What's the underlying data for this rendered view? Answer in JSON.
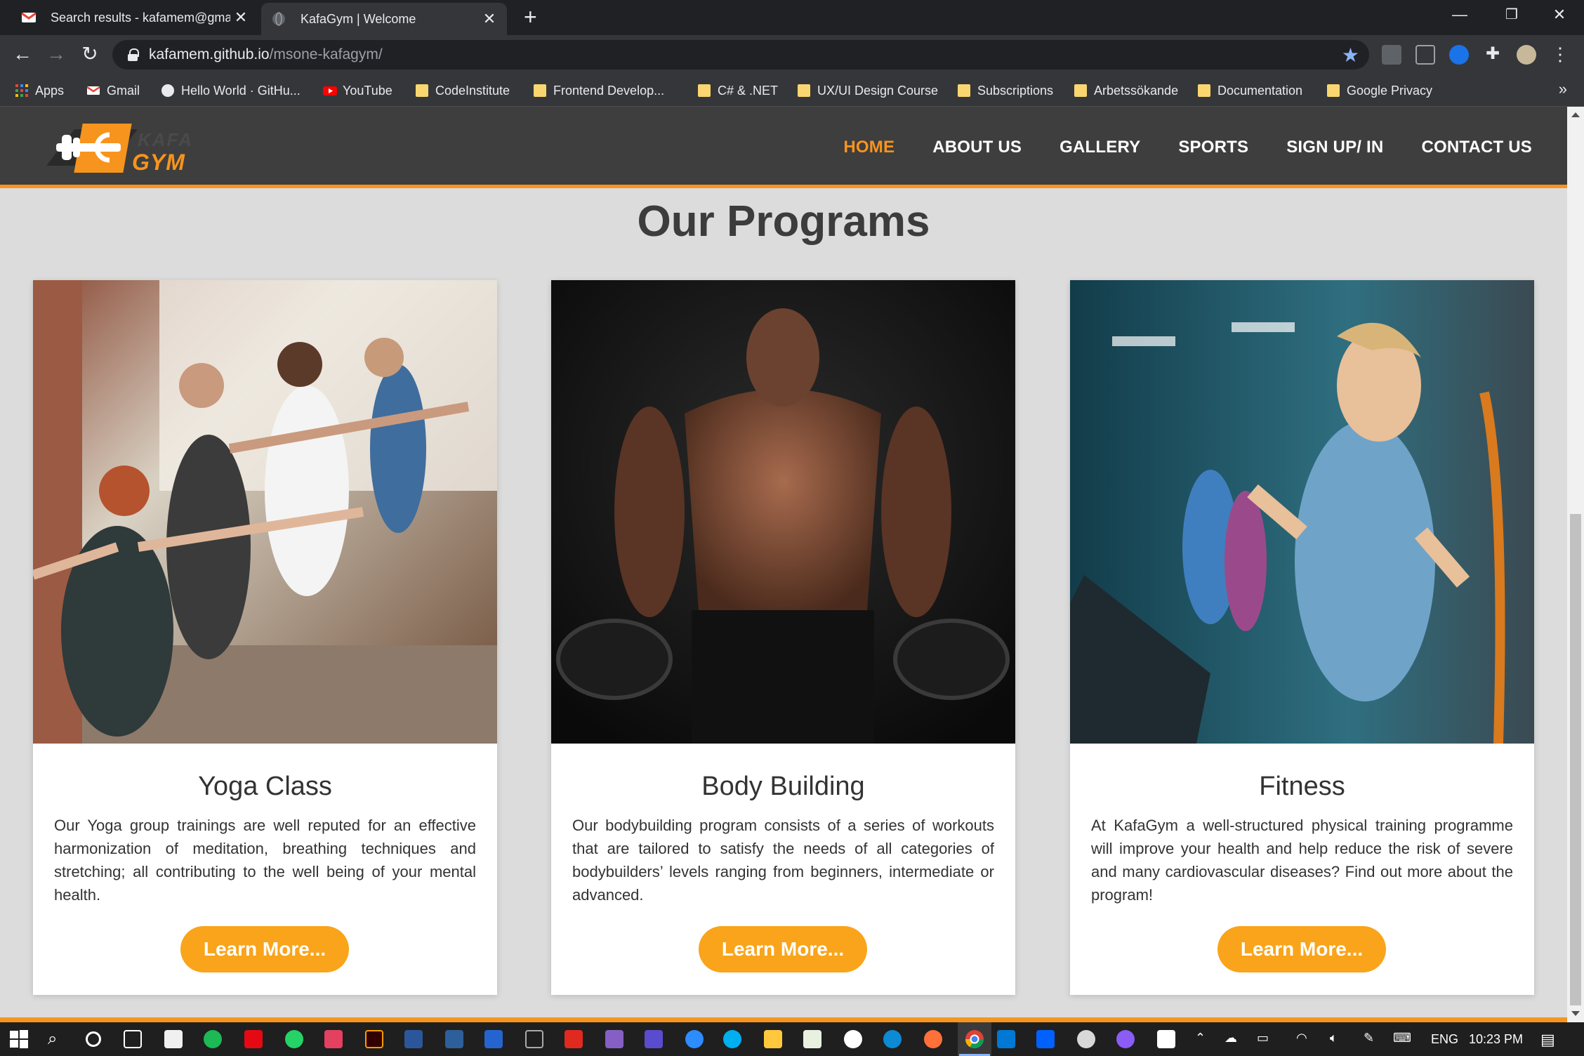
{
  "browser": {
    "tabs": [
      {
        "title": "Search results - kafamem@gmail",
        "icon": "gmail-icon"
      },
      {
        "title": "KafaGym | Welcome",
        "icon": "globe-icon"
      }
    ],
    "address": {
      "host": "kafamem.github.io",
      "path": "/msone-kafagym/"
    },
    "bookmarks": [
      {
        "label": "Apps",
        "icon": "apps-grid-icon"
      },
      {
        "label": "Gmail",
        "icon": "gmail-icon"
      },
      {
        "label": "Hello World · GitHu...",
        "icon": "github-icon"
      },
      {
        "label": "YouTube",
        "icon": "youtube-icon"
      },
      {
        "label": "CodeInstitute",
        "icon": "folder-icon"
      },
      {
        "label": "Frontend Develop...",
        "icon": "folder-icon"
      },
      {
        "label": "C# & .NET",
        "icon": "folder-icon"
      },
      {
        "label": "UX/UI Design Course",
        "icon": "folder-icon"
      },
      {
        "label": "Subscriptions",
        "icon": "folder-icon"
      },
      {
        "label": "Arbetssökande",
        "icon": "folder-icon"
      },
      {
        "label": "Documentation",
        "icon": "folder-icon"
      },
      {
        "label": "Google Privacy",
        "icon": "folder-icon"
      }
    ]
  },
  "site": {
    "logo": {
      "line1": "KAFA",
      "line2": "GYM"
    },
    "nav": [
      {
        "label": "HOME",
        "active": true
      },
      {
        "label": "ABOUT US"
      },
      {
        "label": "GALLERY"
      },
      {
        "label": "SPORTS"
      },
      {
        "label": "SIGN UP/ IN"
      },
      {
        "label": "CONTACT US"
      }
    ],
    "accent_color": "#f7941d",
    "section_title": "Our Programs",
    "programs": [
      {
        "title": "Yoga Class",
        "description": "Our Yoga group trainings are well reputed for an effective harmonization of meditation, breathing techniques and stretching; all contributing to the well being of your mental health.",
        "button": "Learn More...",
        "image": "yoga-class-photo"
      },
      {
        "title": "Body Building",
        "description": "Our bodybuilding program consists of a series of workouts that are tailored to satisfy the needs of all categories of bodybuilders’ levels ranging from beginners, intermediate or advanced.",
        "button": "Learn More...",
        "image": "bodybuilder-photo"
      },
      {
        "title": "Fitness",
        "description": "At KafaGym a well-structured physical training programme will improve your health and help reduce the risk of severe and many cardiovascular diseases? Find out more about the program!",
        "button": "Learn More...",
        "image": "treadmill-runner-photo"
      }
    ]
  },
  "taskbar": {
    "language": "ENG",
    "time": "10:23 PM"
  }
}
